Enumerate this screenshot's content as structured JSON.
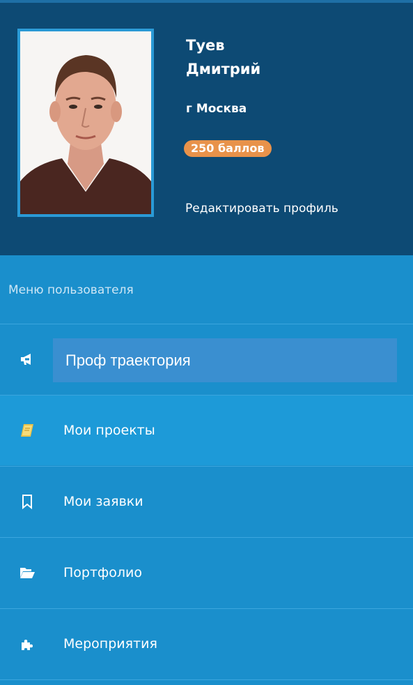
{
  "profile": {
    "last_name": "Туев",
    "first_name": "Дмитрий",
    "city": "г Москва",
    "points": "250 баллов",
    "edit_link": "Редактировать профиль"
  },
  "menu": {
    "title": "Меню пользователя",
    "items": [
      {
        "label": "Проф траектория",
        "icon": "megaphone-icon",
        "active": true
      },
      {
        "label": "Мои проекты",
        "icon": "book-icon"
      },
      {
        "label": "Мои заявки",
        "icon": "bookmark-icon"
      },
      {
        "label": "Портфолио",
        "icon": "folder-open-icon"
      },
      {
        "label": "Мероприятия",
        "icon": "puzzle-icon"
      }
    ]
  },
  "colors": {
    "header_bg": "#0d4a74",
    "menu_bg": "#1a8fcc",
    "points_badge": "#e8924a",
    "active_item": "#3a8fd0"
  }
}
